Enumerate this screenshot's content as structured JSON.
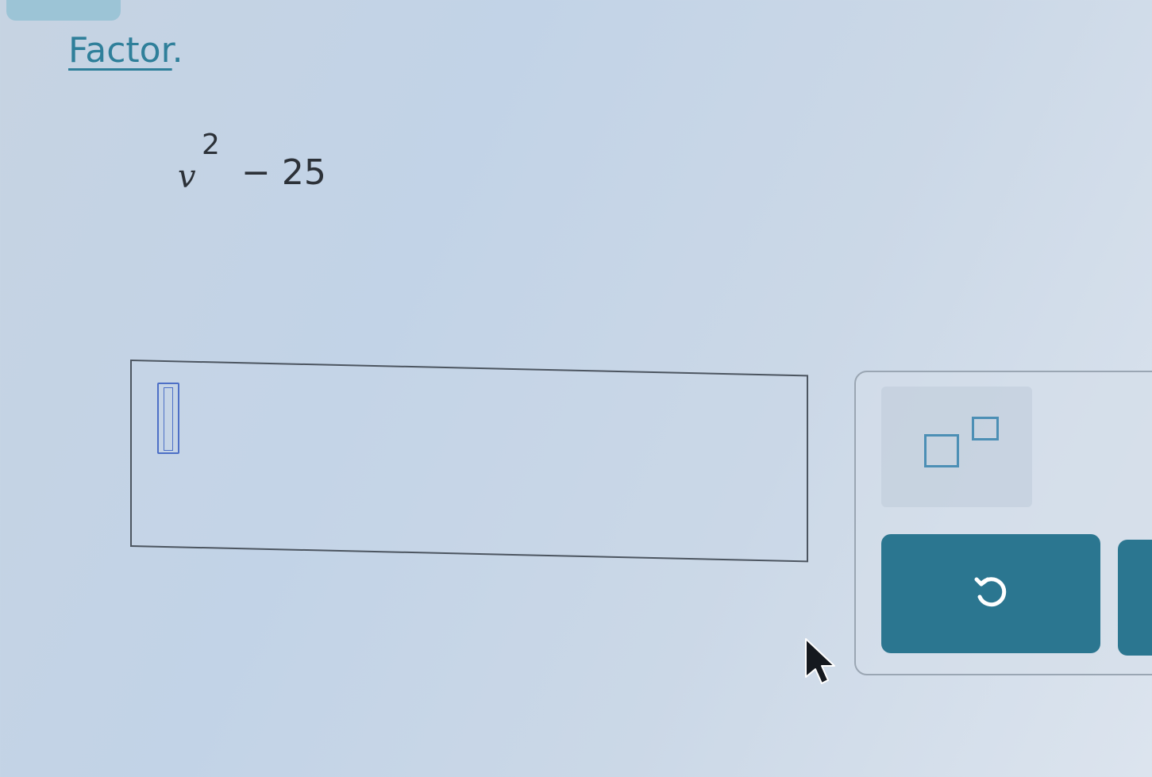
{
  "instruction": {
    "text": "Factor",
    "punctuation": "."
  },
  "problem": {
    "variable": "v",
    "exponent": "2",
    "operator": "−",
    "constant": "25"
  },
  "answer": {
    "value": ""
  },
  "toolbar": {
    "exponent_icon": "exponent-template-icon",
    "undo_icon": "undo-icon"
  },
  "colors": {
    "instruction": "#2f7f9a",
    "button": "#2b7690",
    "icon_outline": "#4c8fb5",
    "cursor": "#4d6fc6"
  }
}
